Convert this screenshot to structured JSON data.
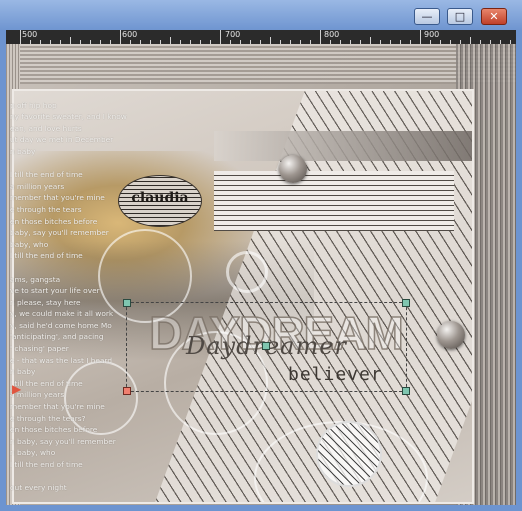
{
  "window": {
    "minimize_glyph": "—",
    "maximize_glyph": "□",
    "close_glyph": "✕"
  },
  "ruler": {
    "labels": [
      "500",
      "600",
      "700",
      "800",
      "900"
    ]
  },
  "lyrics": [
    "",
    "p off hip hop",
    "ny favorite sweater, and I know",
    "ean, and love hurts",
    "ut day we met in December",
    "n baby",
    "",
    "l till the end of time",
    "a million years",
    "member that you're mine",
    "e through the tears",
    "en those bitches before",
    "baby, say you'll remember",
    "baby, who",
    "l till the end of time",
    "",
    "ams, gangsta",
    "ve to start your life over",
    "n please, stay here",
    "y, we could make it all work",
    "y, said he'd come home Mo",
    "'anticipating', and pacing",
    "' chasing' paper",
    "e - that was the last I heard",
    "h baby",
    "l till the end of time",
    "a million years",
    "member that you're mine",
    "e through the tears?",
    "en those bitches before",
    "n baby, say you'll remember",
    "n baby, who",
    "l till the end of time",
    "",
    "out every night"
  ],
  "badge": {
    "text": "claudia"
  },
  "artwork": {
    "title_outline": "DAYDREAM",
    "title_script": "Daydreamer",
    "subtitle": "believer"
  }
}
